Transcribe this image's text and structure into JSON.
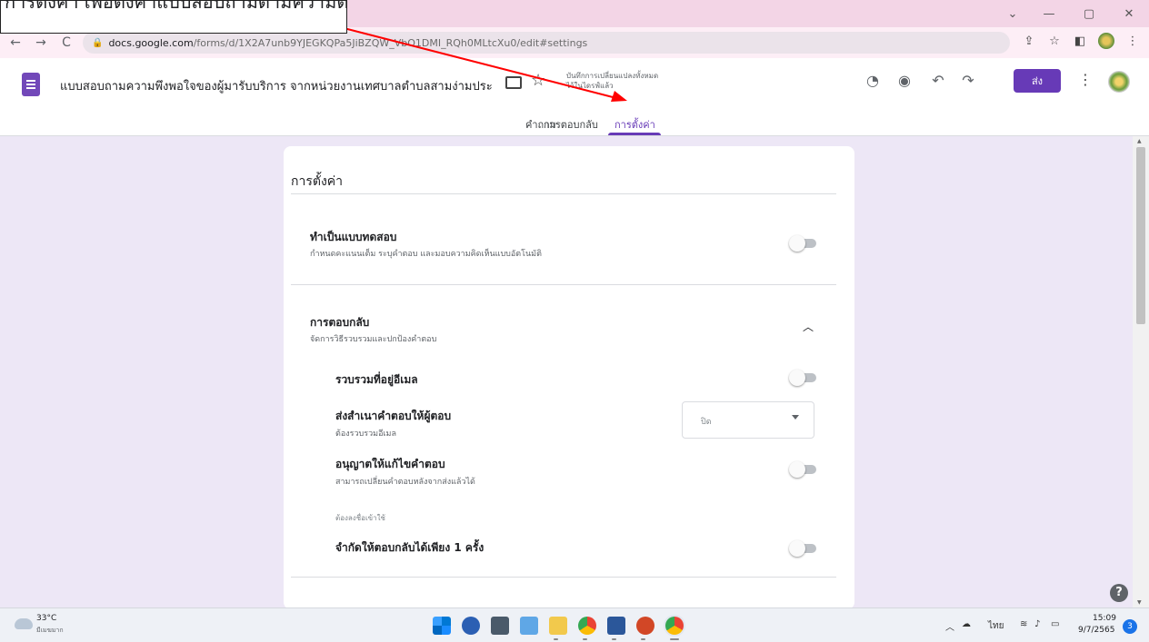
{
  "browser": {
    "url_host": "docs.google.com",
    "url_path": "/forms/d/1X2A7unb9YJEGKQPa5JiBZQW_VbO1DMI_RQh0MLtcXu0/edit#settings"
  },
  "callout": {
    "text": "การตั้งค่า เพื่อตั้งค่าแบบสอบถามตามความต้องการ"
  },
  "header": {
    "form_title": "แบบสอบถามความพึงพอใจของผู้มารับบริการ จากหน่วยงานเทศบาลตำบลสามง่ามประ",
    "saved_line1": "บันทึกการเปลี่ยนแปลงทั้งหมด",
    "saved_line2": "ไว้ในไดรฟ์แล้ว",
    "send_label": "ส่ง"
  },
  "tabs": [
    {
      "label": "คำถาม",
      "active": false
    },
    {
      "label": "การตอบกลับ",
      "active": false
    },
    {
      "label": "การตั้งค่า",
      "active": true
    }
  ],
  "settings": {
    "title": "การตั้งค่า",
    "quiz": {
      "title": "ทำเป็นแบบทดสอบ",
      "subtitle": "กำหนดคะแนนเต็ม ระบุคำตอบ และมอบความคิดเห็นแบบอัตโนมัติ",
      "enabled": false
    },
    "responses": {
      "title": "การตอบกลับ",
      "subtitle": "จัดการวิธีรวบรวมและปกป้องคำตอบ",
      "collect_email": {
        "title": "รวบรวมที่อยู่อีเมล",
        "enabled": false
      },
      "send_copy": {
        "title": "ส่งสำเนาคำตอบให้ผู้ตอบ",
        "subtitle": "ต้องรวบรวมอีเมล",
        "selected": "ปิด"
      },
      "allow_edit": {
        "title": "อนุญาตให้แก้ไขคำตอบ",
        "subtitle": "สามารถเปลี่ยนคำตอบหลังจากส่งแล้วได้",
        "enabled": false
      },
      "signin_note": "ต้องลงชื่อเข้าใช้",
      "limit_one": {
        "title": "จำกัดให้ตอบกลับได้เพียง 1 ครั้ง",
        "enabled": false
      }
    }
  },
  "taskbar": {
    "weather_temp": "33°C",
    "weather_desc": "มีเมฆมาก",
    "language": "ไทย",
    "time": "15:09",
    "date": "9/7/2565",
    "notifications": "3"
  },
  "colors": {
    "accent": "#673ab7",
    "background": "#ede7f6",
    "arrow": "#ff0000"
  }
}
